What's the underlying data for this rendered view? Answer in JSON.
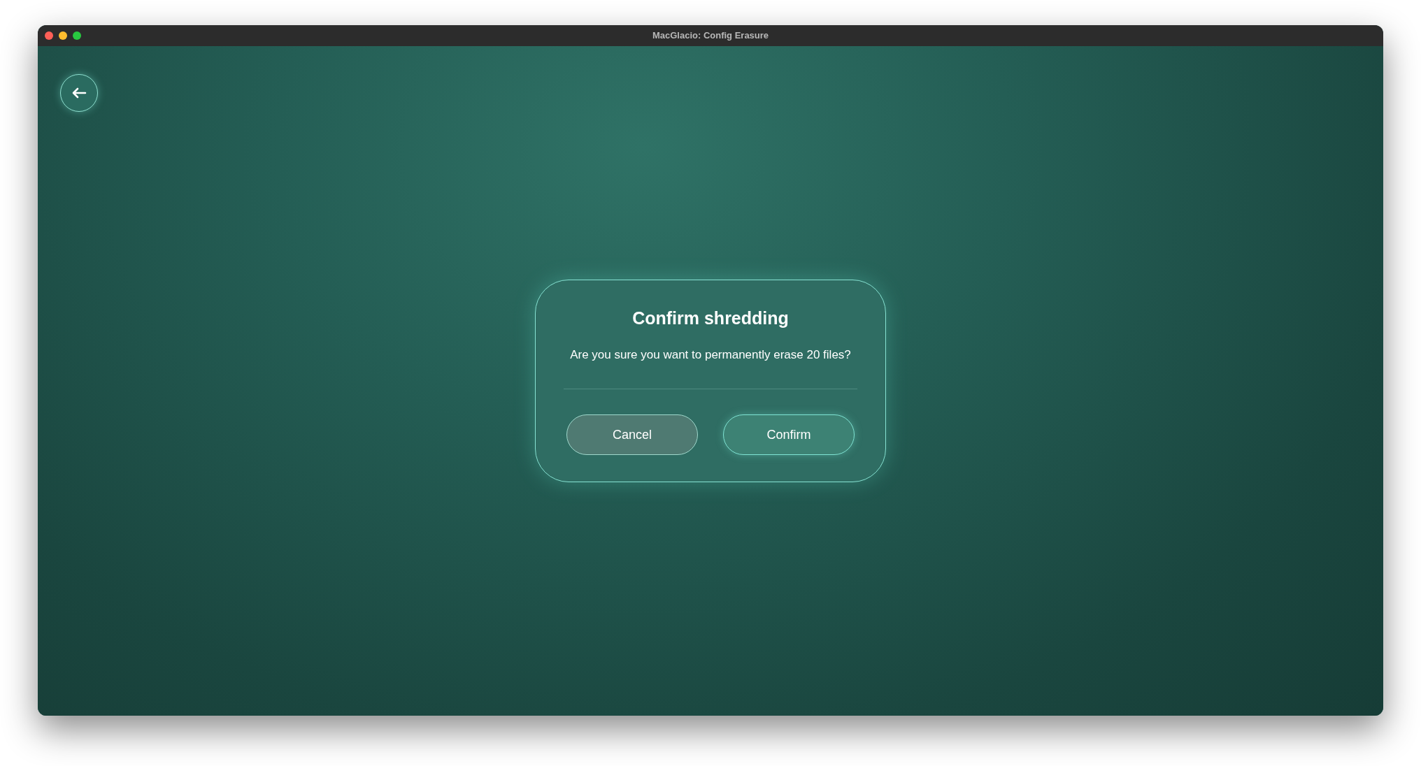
{
  "window": {
    "title": "MacGlacio: Config Erasure"
  },
  "dialog": {
    "title": "Confirm shredding",
    "message": "Are you sure you want to permanently erase 20 files?",
    "buttons": [
      {
        "label": "Cancel",
        "kind": "secondary"
      },
      {
        "label": "Confirm",
        "kind": "primary"
      }
    ]
  }
}
